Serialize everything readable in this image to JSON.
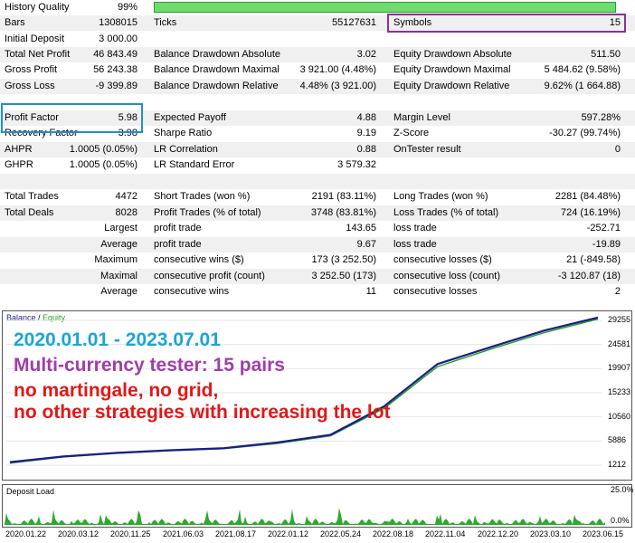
{
  "report": {
    "history_quality": {
      "label": "History Quality",
      "value": "99%",
      "fraction": 0.99
    },
    "bars": {
      "label": "Bars",
      "value": "1308015"
    },
    "ticks": {
      "label": "Ticks",
      "value": "55127631"
    },
    "symbols": {
      "label": "Symbols",
      "value": "15"
    },
    "initial_deposit": {
      "label": "Initial Deposit",
      "value": "3 000.00"
    },
    "total_net_profit": {
      "label": "Total Net Profit",
      "value": "46 843.49"
    },
    "gross_profit": {
      "label": "Gross Profit",
      "value": "56 243.38"
    },
    "gross_loss": {
      "label": "Gross Loss",
      "value": "-9 399.89"
    },
    "balance_dd_abs": {
      "label": "Balance Drawdown Absolute",
      "value": "3.02"
    },
    "balance_dd_max": {
      "label": "Balance Drawdown Maximal",
      "value": "3 921.00 (4.48%)"
    },
    "balance_dd_rel": {
      "label": "Balance Drawdown Relative",
      "value": "4.48% (3 921.00)"
    },
    "equity_dd_abs": {
      "label": "Equity Drawdown Absolute",
      "value": "511.50"
    },
    "equity_dd_max": {
      "label": "Equity Drawdown Maximal",
      "value": "5 484.62 (9.58%)"
    },
    "equity_dd_rel": {
      "label": "Equity Drawdown Relative",
      "value": "9.62% (1 664.88)"
    },
    "profit_factor": {
      "label": "Profit Factor",
      "value": "5.98"
    },
    "recovery_factor": {
      "label": "Recovery Factor",
      "value": "3.98"
    },
    "ahpr": {
      "label": "AHPR",
      "value": "1.0005 (0.05%)"
    },
    "ghpr": {
      "label": "GHPR",
      "value": "1.0005 (0.05%)"
    },
    "expected_payoff": {
      "label": "Expected Payoff",
      "value": "4.88"
    },
    "sharpe_ratio": {
      "label": "Sharpe Ratio",
      "value": "9.19"
    },
    "lr_correlation": {
      "label": "LR Correlation",
      "value": "0.88"
    },
    "lr_std_error": {
      "label": "LR Standard Error",
      "value": "3 579.32"
    },
    "margin_level": {
      "label": "Margin Level",
      "value": "597.28%"
    },
    "z_score": {
      "label": "Z-Score",
      "value": "-30.27 (99.74%)"
    },
    "ontester": {
      "label": "OnTester result",
      "value": "0"
    },
    "total_trades": {
      "label": "Total Trades",
      "value": "4472"
    },
    "total_deals": {
      "label": "Total Deals",
      "value": "8028"
    },
    "short_trades": {
      "label": "Short Trades (won %)",
      "value": "2191 (83.11%)"
    },
    "profit_trades": {
      "label": "Profit Trades (% of total)",
      "value": "3748 (83.81%)"
    },
    "long_trades": {
      "label": "Long Trades (won %)",
      "value": "2281 (84.48%)"
    },
    "loss_trades": {
      "label": "Loss Trades (% of total)",
      "value": "724 (16.19%)"
    },
    "largest": {
      "prefix": "Largest",
      "profit_label": "profit trade",
      "profit_value": "143.65",
      "loss_label": "loss trade",
      "loss_value": "-252.71"
    },
    "average": {
      "prefix": "Average",
      "profit_label": "profit trade",
      "profit_value": "9.67",
      "loss_label": "loss trade",
      "loss_value": "-19.89"
    },
    "maximum": {
      "prefix": "Maximum",
      "profit_label": "consecutive wins ($)",
      "profit_value": "173 (3 252.50)",
      "loss_label": "consecutive losses ($)",
      "loss_value": "21 (-849.58)"
    },
    "maximal": {
      "prefix": "Maximal",
      "profit_label": "consecutive profit (count)",
      "profit_value": "3 252.50 (173)",
      "loss_label": "consecutive loss (count)",
      "loss_value": "-3 120.87 (18)"
    },
    "average2": {
      "prefix": "Average",
      "profit_label": "consecutive wins",
      "profit_value": "11",
      "loss_label": "consecutive losses",
      "loss_value": "2"
    }
  },
  "chart": {
    "legend_balance": "Balance",
    "legend_sep": " / ",
    "legend_equity": "Equity",
    "annotations": [
      "2020.01.01 - 2023.07.01",
      "Multi-currency tester: 15 pairs",
      "no martingale, no grid,",
      "no other strategies with increasing the lot"
    ],
    "colors": {
      "balance": "#1c1c8c",
      "equity": "#22a022",
      "ann_blue": "#19a6d8",
      "ann_purple": "#a03ea8",
      "ann_red": "#e01818"
    }
  },
  "chart_data": {
    "type": "line",
    "x_labels": [
      "2020.01.22",
      "2020.03.12",
      "2020.11.25",
      "2021.06.03",
      "2021.08.17",
      "2022.01.12",
      "2022.05.24",
      "2022.08.18",
      "2022.11.04",
      "2022.12.20",
      "2023.03.10",
      "2023.06.15"
    ],
    "y_ticks": [
      "29255",
      "24581",
      "19907",
      "15233",
      "10560",
      "5886",
      "1212"
    ],
    "ylim": [
      1212,
      29255
    ],
    "series": [
      {
        "name": "Balance",
        "values": [
          1800,
          2900,
          3600,
          4100,
          4500,
          5600,
          7100,
          12600,
          20800,
          24100,
          27300,
          29800
        ]
      },
      {
        "name": "Equity",
        "values": [
          1600,
          2800,
          3500,
          4000,
          4400,
          5400,
          6900,
          12200,
          20300,
          23700,
          26900,
          29500
        ]
      }
    ]
  },
  "deposit_load": {
    "title": "Deposit Load",
    "max_label": "25.0%",
    "min_label": "0.0%",
    "ylim": [
      0,
      25
    ]
  }
}
